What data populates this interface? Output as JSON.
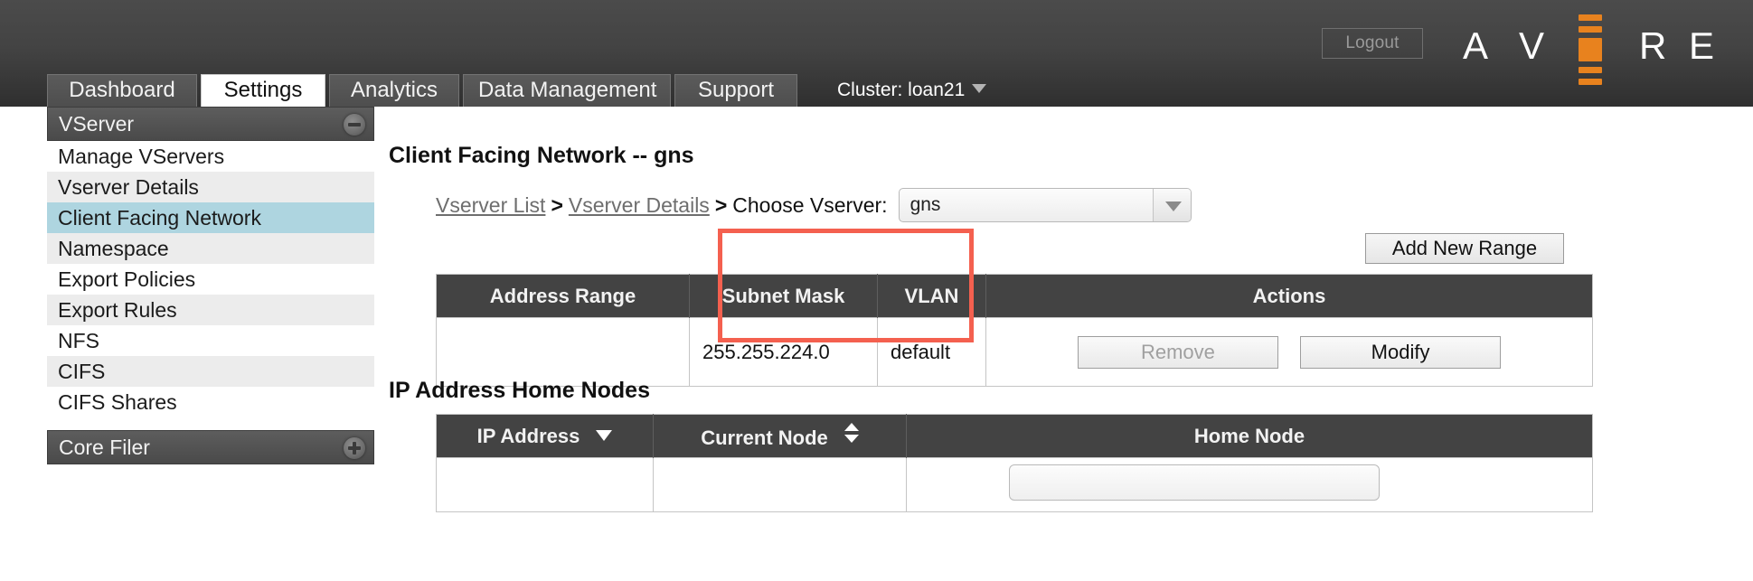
{
  "header": {
    "logout_label": "Logout",
    "brand_letters": [
      "A",
      "V",
      "R",
      "E"
    ],
    "brand_name": "AVERE",
    "accent_color": "#e8821e"
  },
  "tabs": [
    {
      "label": "Dashboard",
      "active": false
    },
    {
      "label": "Settings",
      "active": true
    },
    {
      "label": "Analytics",
      "active": false
    },
    {
      "label": "Data Management",
      "active": false
    },
    {
      "label": "Support",
      "active": false
    }
  ],
  "cluster": {
    "label": "Cluster: loan21"
  },
  "sidebar": {
    "groups": [
      {
        "title": "VServer",
        "toggle": "collapse-icon",
        "items": [
          {
            "label": "Manage VServers",
            "selected": false
          },
          {
            "label": "Vserver Details",
            "selected": false
          },
          {
            "label": "Client Facing Network",
            "selected": true
          },
          {
            "label": "Namespace",
            "selected": false
          },
          {
            "label": "Export Policies",
            "selected": false
          },
          {
            "label": "Export Rules",
            "selected": false
          },
          {
            "label": "NFS",
            "selected": false
          },
          {
            "label": "CIFS",
            "selected": false
          },
          {
            "label": "CIFS Shares",
            "selected": false
          }
        ]
      },
      {
        "title": "Core Filer",
        "toggle": "expand-icon",
        "items": []
      }
    ]
  },
  "main": {
    "page_title": "Client Facing Network -- gns",
    "breadcrumb": {
      "link1": "Vserver List",
      "sep1": ">",
      "link2": "Vserver Details",
      "sep2": ">",
      "label": "Choose Vserver:",
      "vserver_value": "gns"
    },
    "add_new_range_label": "Add New Range",
    "ranges_table": {
      "columns": [
        "Address Range",
        "Subnet Mask",
        "VLAN",
        "Actions"
      ],
      "rows": [
        {
          "address_range": "",
          "subnet_mask": "255.255.224.0",
          "vlan": "default",
          "remove_label": "Remove",
          "remove_disabled": true,
          "modify_label": "Modify",
          "modify_disabled": false
        }
      ]
    },
    "highlight": {
      "color": "#f4604f",
      "target": "address-range-column"
    },
    "home_nodes": {
      "title": "IP Address Home Nodes",
      "columns": [
        {
          "label": "IP Address",
          "sort": "desc"
        },
        {
          "label": "Current Node",
          "sort": "none"
        },
        {
          "label": "Home Node",
          "sort": null
        }
      ],
      "rows": [
        {
          "ip_address": "",
          "current_node": "",
          "home_node": ""
        }
      ]
    }
  }
}
